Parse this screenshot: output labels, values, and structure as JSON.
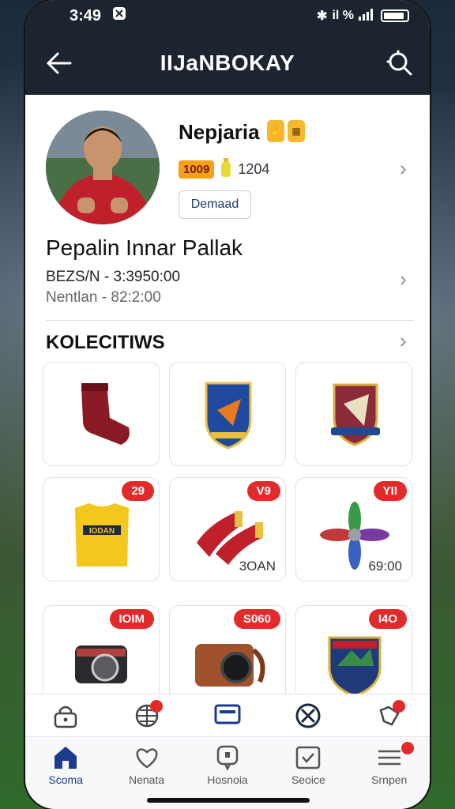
{
  "status": {
    "time": "3:49",
    "signal_text": "il %"
  },
  "header": {
    "title": "IIJaNBOKAY"
  },
  "profile": {
    "name": "Nepjaria",
    "coins": "1009",
    "count": "1204",
    "demand_label": "Demaad",
    "player_title": "Pepalin Innar Pallak",
    "line1": "BEZS/N - 3:3950:00",
    "line2": "Nentlan - 82:2:00"
  },
  "collections": {
    "title": "KOLECITIWS",
    "items": [
      {
        "name": "sock",
        "price": "",
        "label": ""
      },
      {
        "name": "shield-badge",
        "price": "",
        "label": ""
      },
      {
        "name": "club-crest",
        "price": "",
        "label": ""
      },
      {
        "name": "yellow-jersey",
        "price": "29",
        "label": "",
        "jersey_text": "IODAN"
      },
      {
        "name": "red-gloves",
        "price": "V9",
        "label": "3OAN"
      },
      {
        "name": "pinwheel",
        "price": "YII",
        "label": "69:00"
      },
      {
        "name": "camera",
        "price": "IOIM",
        "label": ""
      },
      {
        "name": "brown-camera",
        "price": "S060",
        "label": ""
      },
      {
        "name": "mountain-crest",
        "price": "I4O",
        "label": ""
      }
    ]
  },
  "tabbar": {
    "items": [
      {
        "label": "Scoma"
      },
      {
        "label": "Nenata"
      },
      {
        "label": "Hosnoia"
      },
      {
        "label": "Seoice"
      },
      {
        "label": "Srnpen"
      }
    ]
  },
  "colors": {
    "header": "#1c2430",
    "accent": "#1c3a8e",
    "price": "#e12b2b"
  }
}
